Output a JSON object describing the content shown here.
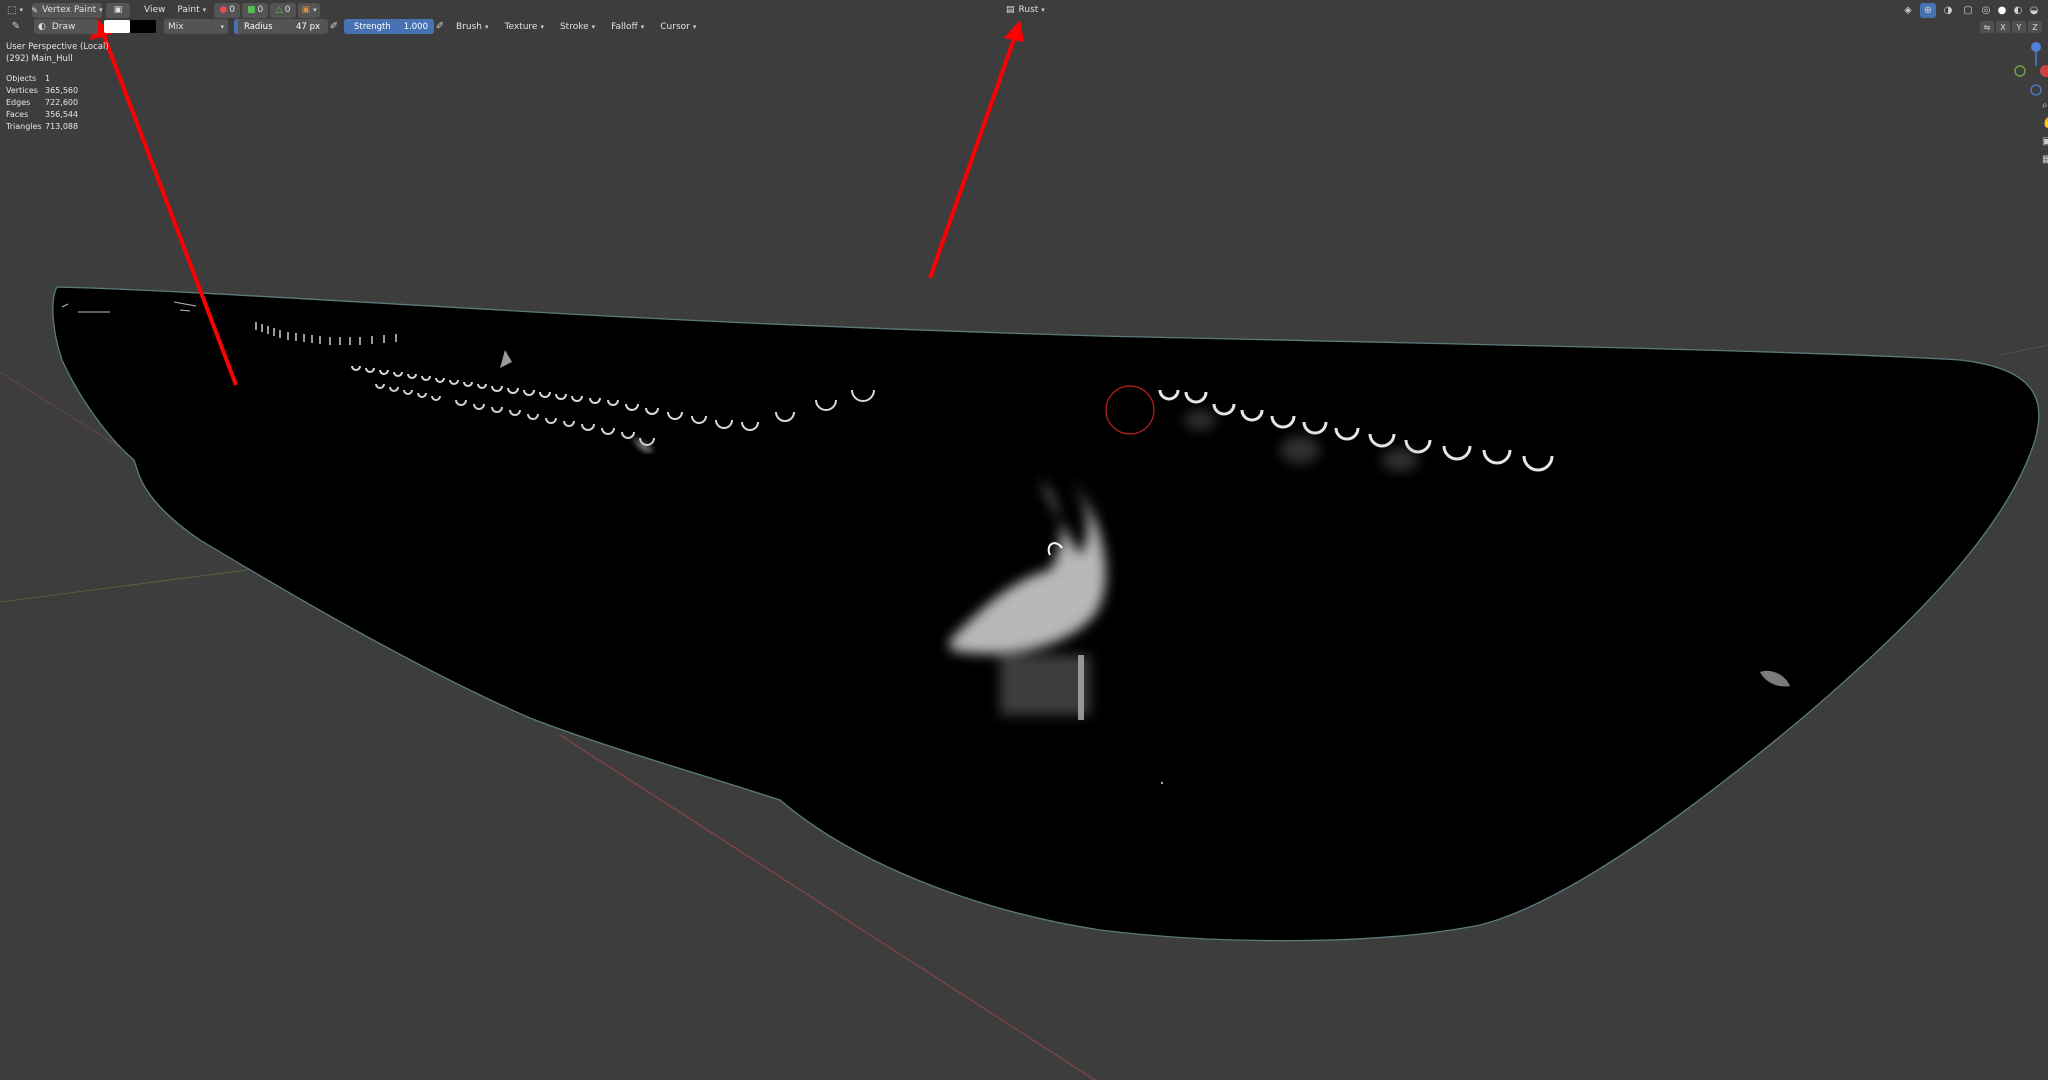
{
  "header": {
    "mode": "Vertex Paint",
    "menus": [
      "View",
      "Paint"
    ],
    "counts": [
      "0",
      "0",
      "0"
    ],
    "center_label": "Rust"
  },
  "tool_settings": {
    "brush_name": "Draw",
    "blend_mode": "Mix",
    "radius_label": "Radius",
    "radius_value": "47 px",
    "strength_label": "Strength",
    "strength_value": "1.000",
    "strength_fraction": 1.0,
    "dropdowns": [
      "Brush",
      "Texture",
      "Stroke",
      "Falloff",
      "Cursor"
    ],
    "colors": {
      "primary": "#ffffff",
      "secondary": "#000000"
    }
  },
  "viewport": {
    "perspective": "User Perspective (Local)",
    "object": "(292) Main_Hull",
    "stats": [
      {
        "label": "Objects",
        "value": "1"
      },
      {
        "label": "Vertices",
        "value": "365,560"
      },
      {
        "label": "Edges",
        "value": "722,600"
      },
      {
        "label": "Faces",
        "value": "356,544"
      },
      {
        "label": "Triangles",
        "value": "713,088"
      }
    ],
    "axis_buttons": [
      "X",
      "Y",
      "Z"
    ]
  },
  "colors": {
    "accent": "#4772b3",
    "arrow": "#ff0000",
    "background": "#3d3d3d"
  }
}
